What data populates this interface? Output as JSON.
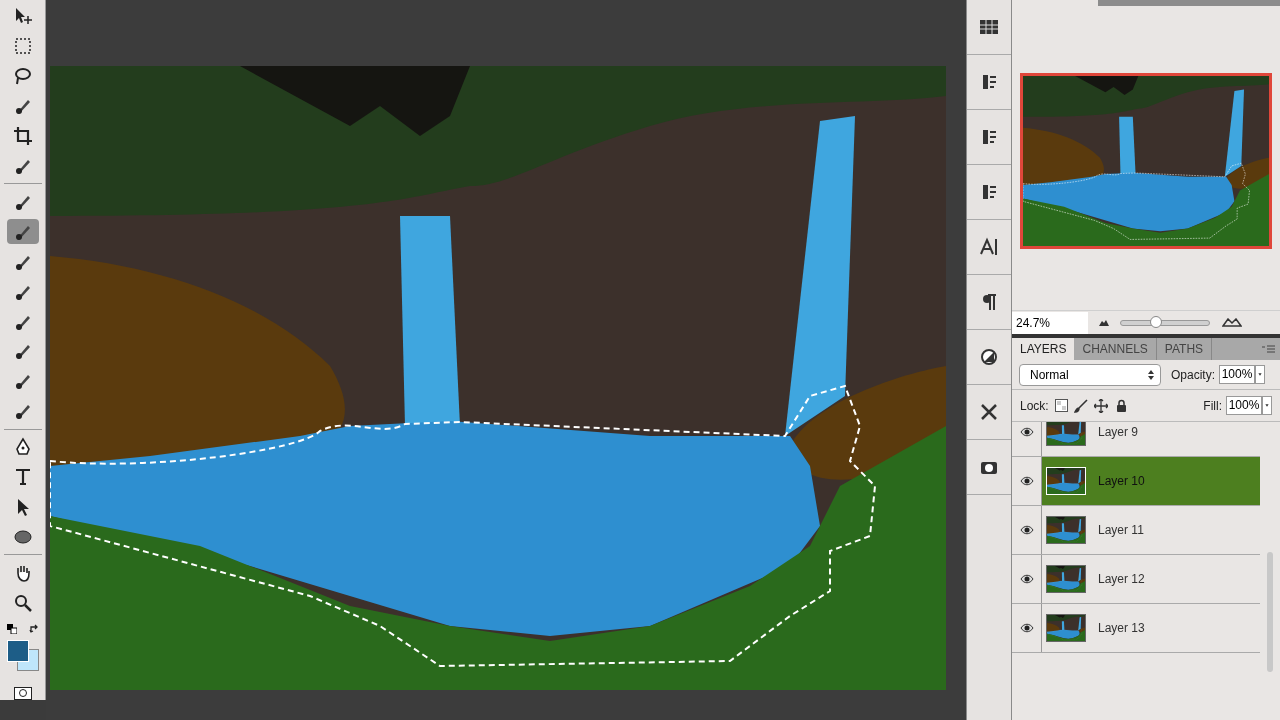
{
  "navigator": {
    "zoom": "24.7%",
    "zoom_slider": {
      "level": 0.4
    }
  },
  "layers_panel": {
    "tabs": [
      {
        "label": "LAYERS",
        "selected": true
      },
      {
        "label": "CHANNELS",
        "selected": false
      },
      {
        "label": "PATHS",
        "selected": false
      }
    ],
    "blend_mode": "Normal",
    "opacity_label": "Opacity:",
    "opacity": "100%",
    "lock_label": "Lock:",
    "fill_label": "Fill:",
    "fill": "100%",
    "layers": [
      {
        "name": "Layer 9",
        "visible": true,
        "selected": false
      },
      {
        "name": "Layer 10",
        "visible": true,
        "selected": true
      },
      {
        "name": "Layer 11",
        "visible": true,
        "selected": false
      },
      {
        "name": "Layer 12",
        "visible": true,
        "selected": false
      },
      {
        "name": "Layer 13",
        "visible": true,
        "selected": false
      }
    ]
  }
}
